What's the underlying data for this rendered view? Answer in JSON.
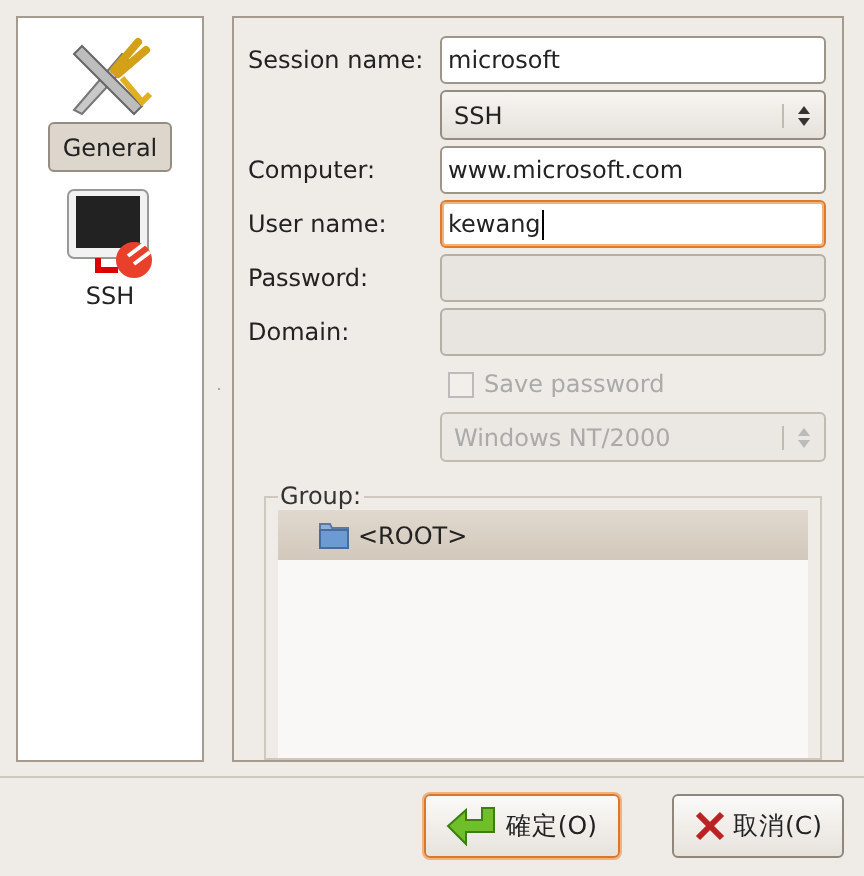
{
  "sidebar": {
    "items": [
      {
        "label": "General",
        "kind": "tools",
        "selected": true
      },
      {
        "label": "SSH",
        "kind": "terminal",
        "selected": false
      }
    ]
  },
  "form": {
    "fields": [
      {
        "kind": "text",
        "label": "Session name:",
        "value": "microsoft",
        "disabled": false,
        "focused": false
      },
      {
        "kind": "select",
        "value": "SSH",
        "disabled": false
      },
      {
        "kind": "text",
        "label": "Computer:",
        "value": "www.microsoft.com",
        "disabled": false,
        "focused": false
      },
      {
        "kind": "text",
        "label": "User name:",
        "value": "kewang",
        "disabled": false,
        "focused": true
      },
      {
        "kind": "text",
        "label": "Password:",
        "disabled": true,
        "focused": false
      },
      {
        "kind": "text",
        "label": "Domain:",
        "disabled": true,
        "focused": false
      },
      {
        "kind": "checkbox",
        "label": "Save password",
        "checked": false,
        "disabled": true
      },
      {
        "kind": "select",
        "value": "Windows NT/2000",
        "disabled": true
      }
    ],
    "group": {
      "label": "Group:",
      "items": [
        {
          "label": "<ROOT>",
          "selected": true
        }
      ]
    }
  },
  "buttons": [
    {
      "label": "確定(O)",
      "kind": "ok",
      "default": true
    },
    {
      "label": "取消(C)",
      "kind": "cancel",
      "default": false
    }
  ]
}
